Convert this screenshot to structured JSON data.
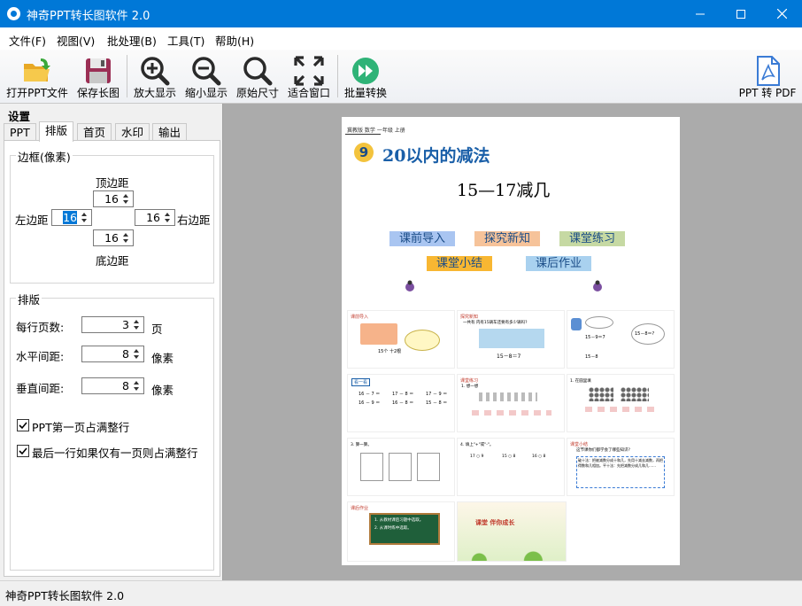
{
  "window": {
    "title": "神奇PPT转长图软件 2.0"
  },
  "menu": [
    "文件(F)",
    "视图(V)",
    "批处理(B)",
    "工具(T)",
    "帮助(H)"
  ],
  "toolbar": {
    "open_ppt": "打开PPT文件",
    "save_image": "保存长图",
    "zoom_in": "放大显示",
    "zoom_out": "缩小显示",
    "original_size": "原始尺寸",
    "fit_window": "适合窗口",
    "batch_convert": "批量转换",
    "ppt_to_pdf": "PPT 转 PDF"
  },
  "panel": {
    "title": "设置",
    "tabs": [
      "PPT",
      "排版",
      "首页",
      "水印",
      "输出"
    ],
    "active_tab": "排版",
    "border_group": {
      "title": "边框(像素)",
      "top_label": "顶边距",
      "top_value": "16",
      "left_label": "左边距",
      "left_value": "16",
      "right_label": "右边距",
      "right_value": "16",
      "bottom_label": "底边距",
      "bottom_value": "16"
    },
    "layout_group": {
      "title": "排版",
      "per_row_label": "每行页数:",
      "per_row_value": "3",
      "per_row_unit": "页",
      "hgap_label": "水平间距:",
      "hgap_value": "8",
      "hgap_unit": "像素",
      "vgap_label": "垂直间距:",
      "vgap_value": "8",
      "vgap_unit": "像素"
    },
    "options": [
      {
        "label": "PPT第一页占满整行",
        "checked": true
      },
      {
        "label": "最后一行如果仅有一页则占满整行",
        "checked": true
      }
    ]
  },
  "preview": {
    "header": "冀教版   数学   一年级   上册",
    "lesson_number": "9",
    "lesson_title": "20以内的减法",
    "subtitle": "15—17减几",
    "sections": [
      "课前导入",
      "探究新知",
      "课堂练习",
      "课堂小结",
      "课后作业"
    ],
    "thumbs": {
      "t1_title": "课前导入",
      "t1_caption": "15个  十2根",
      "t2_title": "探究新知",
      "t2_question": "一共有 内有15辆车还要有多少辆吗?",
      "t2_eq": "15－8＝7",
      "t3_eq1": "15－9＝7",
      "t3_eq2": "15－8＝?",
      "t3_eq3": "15－8",
      "t4_title": "看一看",
      "t4_rows": [
        "16 － 7 ＝",
        "17 － 8 ＝",
        "17 － 9 ＝",
        "16 － 9 ＝",
        "16 － 8 ＝",
        "15 － 8 ＝"
      ],
      "t5_title": "课堂练习",
      "t5_q": "1. 想一想",
      "t6_q": "1. 在圆里填",
      "t7_q": "3. 算一算。",
      "t8_q": "4. 填上\"+\"或\"-\"。",
      "t8_rows": [
        "17 ○ 9",
        "15 ○ 8",
        "16 ○ 8"
      ],
      "t9_title": "课堂小结",
      "t9_q": "这节课你们都学会了哪些知识?",
      "t9_text": "破十法：把被减数分成十和几，先用十减去减数，再把得数和几相加。平十法：先把减数分成几和几……",
      "t10_title": "课后作业",
      "t10_items": [
        "1. 从教材课后习题中选取。",
        "2. 从课时练中选取。"
      ],
      "t11_caption": "课堂  伴你成长"
    }
  },
  "status": {
    "text": "神奇PPT转长图软件 2.0"
  },
  "colors": {
    "titlebar": "#0078d7",
    "canvas": "#ababab",
    "accent_blue": "#1a4c87"
  }
}
